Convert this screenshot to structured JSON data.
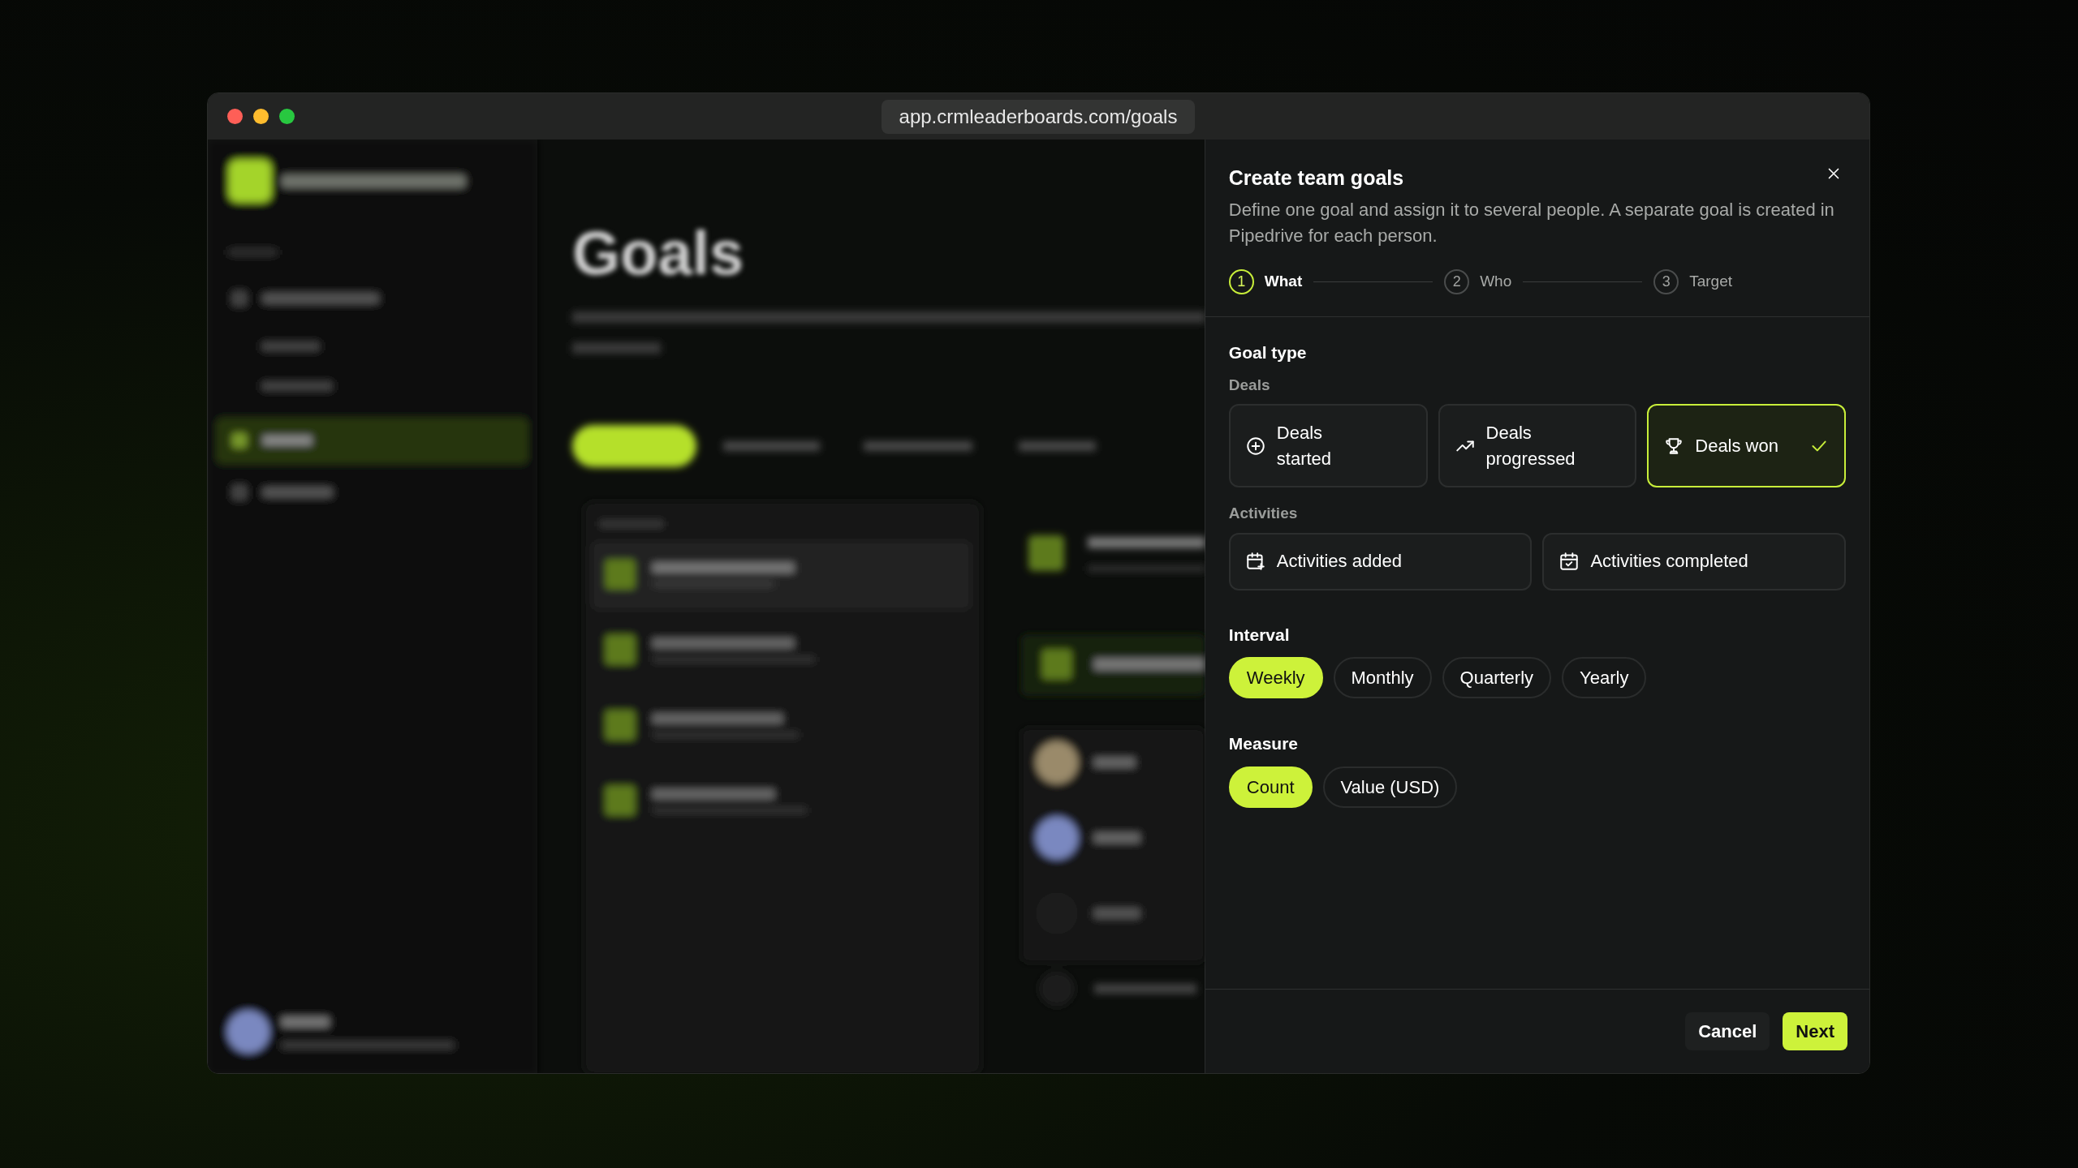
{
  "window": {
    "url": "app.crmleaderboards.com/goals"
  },
  "background": {
    "title": "Goals"
  },
  "dialog": {
    "title": "Create team goals",
    "description": "Define one goal and assign it to several people. A separate goal is created in Pipedrive for each person.",
    "steps": [
      {
        "number": "1",
        "label": "What",
        "selected": true
      },
      {
        "number": "2",
        "label": "Who",
        "selected": false
      },
      {
        "number": "3",
        "label": "Target",
        "selected": false
      }
    ],
    "goal_type": {
      "heading": "Goal type",
      "groups": [
        {
          "label": "Deals",
          "options": [
            {
              "label": "Deals started",
              "selected": false
            },
            {
              "label": "Deals progressed",
              "selected": false
            },
            {
              "label": "Deals won",
              "selected": true
            }
          ]
        },
        {
          "label": "Activities",
          "options": [
            {
              "label": "Activities added",
              "selected": false
            },
            {
              "label": "Activities completed",
              "selected": false
            }
          ]
        }
      ]
    },
    "interval": {
      "heading": "Interval",
      "options": [
        {
          "label": "Weekly",
          "selected": true
        },
        {
          "label": "Monthly",
          "selected": false
        },
        {
          "label": "Quarterly",
          "selected": false
        },
        {
          "label": "Yearly",
          "selected": false
        }
      ]
    },
    "measure": {
      "heading": "Measure",
      "options": [
        {
          "label": "Count",
          "selected": true
        },
        {
          "label": "Value (USD)",
          "selected": false
        }
      ]
    },
    "buttons": [
      "Cancel",
      "Next"
    ]
  }
}
